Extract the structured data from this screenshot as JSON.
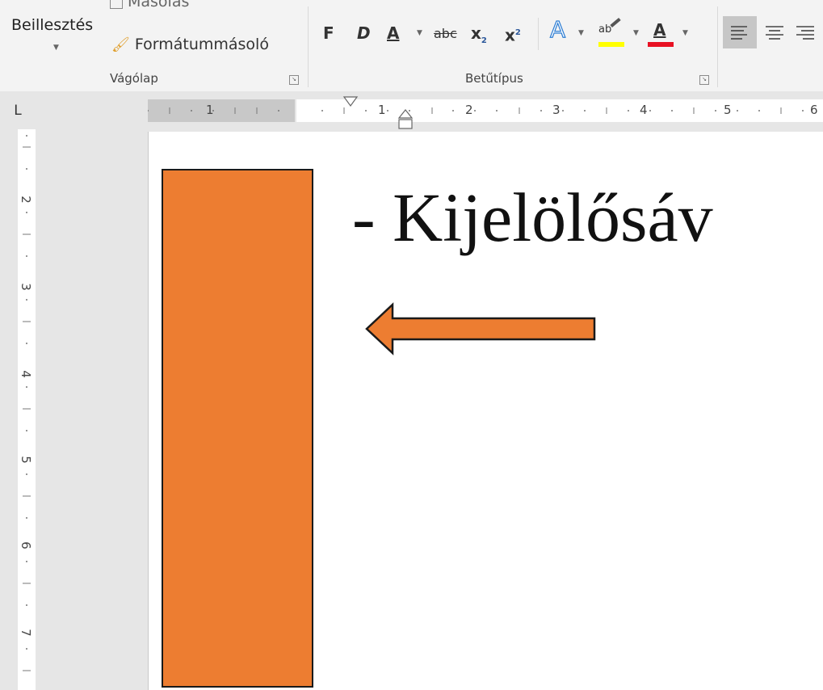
{
  "ribbon": {
    "clipboard": {
      "paste_label": "Beillesztés",
      "copy_label": "Másolás",
      "format_painter_label": "Formátummásoló",
      "group_label": "Vágólap"
    },
    "font": {
      "bold_label": "F",
      "italic_label": "D",
      "underline_label": "A",
      "strikethrough_label": "abc",
      "subscript_label": "x",
      "subscript_sub": "2",
      "superscript_label": "x",
      "superscript_sup": "2",
      "text_effects_label": "A",
      "highlight_label": "ab",
      "font_color_label": "A",
      "group_label": "Betűtípus",
      "highlight_color": "#ffff00",
      "font_color": "#e81123"
    }
  },
  "ruler": {
    "left_numbers": [
      "1"
    ],
    "numbers": [
      "1",
      "2",
      "3",
      "4",
      "5",
      "6"
    ],
    "tab_selector_label": "L"
  },
  "vruler": {
    "numbers": [
      "2",
      "3",
      "4",
      "5",
      "6",
      "7"
    ]
  },
  "document": {
    "text": "- Kijelölősáv",
    "shape_fill": "#ed7d31",
    "shape_stroke": "#1a1a1a"
  }
}
